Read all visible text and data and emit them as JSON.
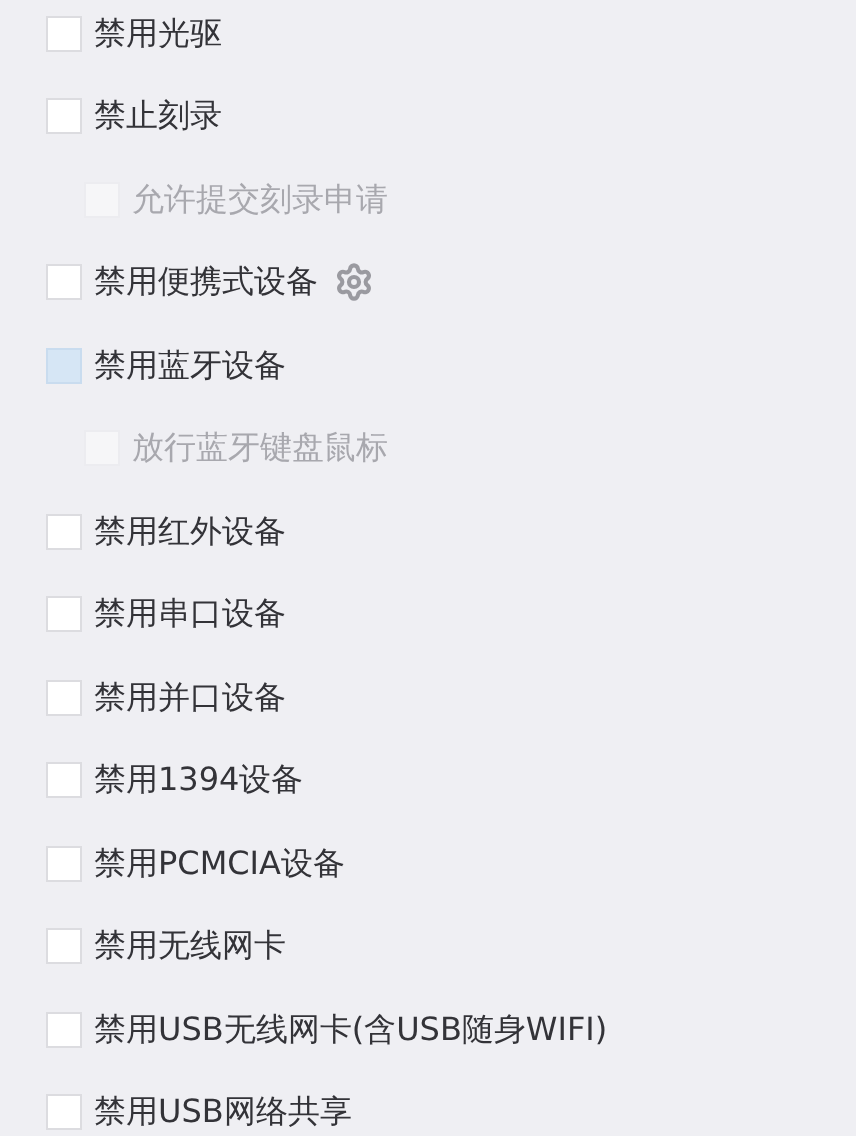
{
  "options": [
    {
      "label": "禁用光驱",
      "checked": false,
      "highlighted": false,
      "disabled": false,
      "settings": false
    },
    {
      "label": "禁止刻录",
      "checked": false,
      "highlighted": false,
      "disabled": false,
      "settings": false,
      "children": [
        {
          "label": "允许提交刻录申请",
          "checked": false,
          "highlighted": false,
          "disabled": true,
          "settings": false
        }
      ]
    },
    {
      "label": "禁用便携式设备",
      "checked": false,
      "highlighted": false,
      "disabled": false,
      "settings": true
    },
    {
      "label": "禁用蓝牙设备",
      "checked": false,
      "highlighted": true,
      "disabled": false,
      "settings": false,
      "children": [
        {
          "label": "放行蓝牙键盘鼠标",
          "checked": false,
          "highlighted": false,
          "disabled": true,
          "settings": false
        }
      ]
    },
    {
      "label": "禁用红外设备",
      "checked": false,
      "highlighted": false,
      "disabled": false,
      "settings": false
    },
    {
      "label": "禁用串口设备",
      "checked": false,
      "highlighted": false,
      "disabled": false,
      "settings": false
    },
    {
      "label": "禁用并口设备",
      "checked": false,
      "highlighted": false,
      "disabled": false,
      "settings": false
    },
    {
      "label": "禁用1394设备",
      "checked": false,
      "highlighted": false,
      "disabled": false,
      "settings": false
    },
    {
      "label": "禁用PCMCIA设备",
      "checked": false,
      "highlighted": false,
      "disabled": false,
      "settings": false
    },
    {
      "label": "禁用无线网卡",
      "checked": false,
      "highlighted": false,
      "disabled": false,
      "settings": false
    },
    {
      "label": "禁用USB无线网卡(含USB随身WIFI)",
      "checked": false,
      "highlighted": false,
      "disabled": false,
      "settings": false
    },
    {
      "label": "禁用USB网络共享",
      "checked": false,
      "highlighted": false,
      "disabled": false,
      "settings": false
    }
  ]
}
